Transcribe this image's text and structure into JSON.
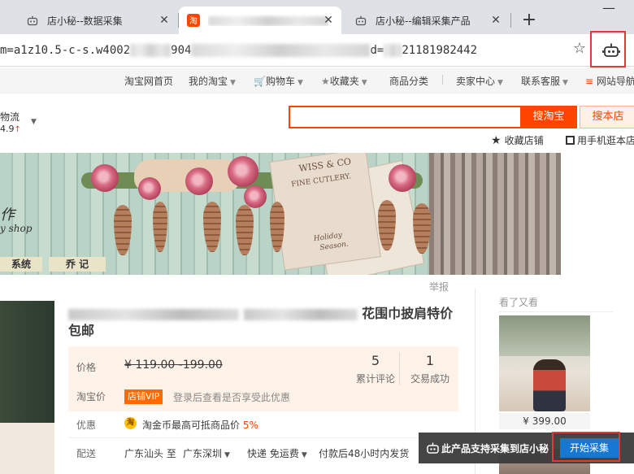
{
  "browser": {
    "tabs": [
      {
        "label": "店小秘--数据采集",
        "icon": "robot-icon",
        "active": false
      },
      {
        "label": "",
        "icon": "taobao-icon",
        "active": true
      },
      {
        "label": "店小秘--编辑采集产品",
        "icon": "robot-icon",
        "active": false
      }
    ],
    "new_tab": "+",
    "url_start": "m=a1z10.5-c-s.w4002",
    "url_mid": "d=",
    "url_end": "21181982442"
  },
  "site_nav": {
    "items": [
      "淘宝网首页",
      "我的淘宝",
      "购物车",
      "收藏夹",
      "商品分类",
      "卖家中心",
      "联系客服",
      "网站导航"
    ]
  },
  "shop": {
    "logistics": "物流",
    "rating": "4.9",
    "search_button": "搜淘宝",
    "search_shop_button": "搜本店",
    "favorite_shop": "收藏店铺",
    "mobile_shop": "用手机逛本店"
  },
  "banner": {
    "script_line1": "作",
    "script_line2": "y shop",
    "pill1": "系统",
    "pill2": "乔 记",
    "card_line1": "WISS & CO",
    "card_line2": "FINE CUTLERY.",
    "card_line3": "Holiday",
    "card_line4": "Season."
  },
  "report": "举报",
  "product": {
    "title_visible": "花围巾披肩特价",
    "title_line2": "包邮",
    "price_label": "价格",
    "price_original": "¥ 119.00 -199.00",
    "stats": [
      {
        "value": "5",
        "label": "累计评论"
      },
      {
        "value": "1",
        "label": "交易成功"
      }
    ],
    "tb_price_label": "淘宝价",
    "vip_badge": "店铺VIP",
    "vip_text": "登录后查看是否享受此优惠",
    "discount_label": "优惠",
    "coin_icon": "淘",
    "coin_text": "淘金币最高可抵商品价",
    "coin_pct": "5%",
    "ship_label": "配送",
    "ship_from": "广东汕头 至",
    "ship_to": "广东深圳",
    "ship_method": "快递 免运费",
    "ship_time": "付款后48小时内发货"
  },
  "sidebar": {
    "see_also": "看了又看",
    "price": "¥ 399.00"
  },
  "extension": {
    "collect_text": "此产品支持采集到店小秘",
    "collect_button": "开始采集"
  },
  "colors": {
    "taobao_orange": "#ff4400",
    "highlight_red": "#e53935",
    "collect_blue": "#1678d2"
  }
}
